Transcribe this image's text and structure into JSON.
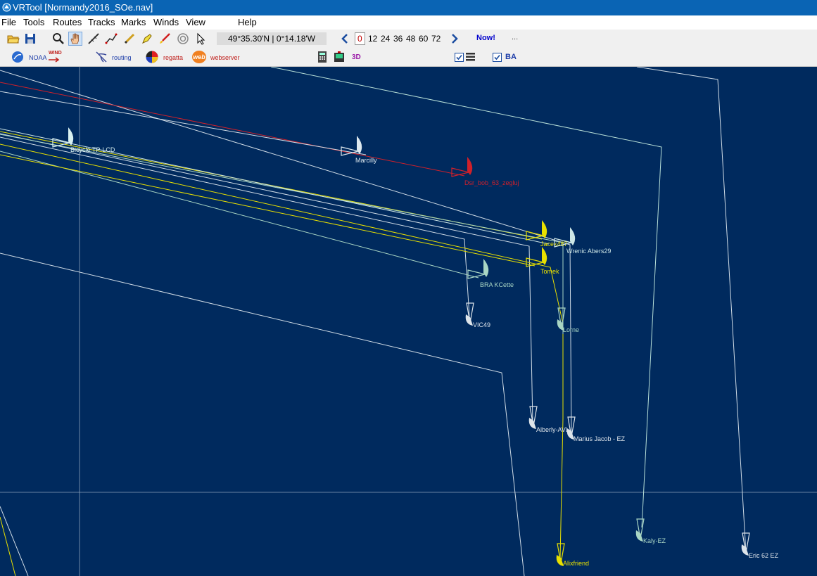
{
  "window": {
    "title": "VRTool [Normandy2016_SOe.nav]"
  },
  "menu": {
    "items": [
      "File",
      "Tools",
      "Routes",
      "Tracks",
      "Marks",
      "Winds",
      "View",
      "Help"
    ]
  },
  "toolbar": {
    "coordinates": "49°35.30'N | 0°14.18'W",
    "hours": [
      "0",
      "12",
      "24",
      "36",
      "48",
      "60",
      "72"
    ],
    "selected_hour": "0",
    "now_label": "Now!",
    "more_label": "...",
    "noaa_label": "NOAA",
    "wind_label": "WIND",
    "routing_label": "routing",
    "regatta_label": "regatta",
    "webserver_label": "webserver",
    "web_badge": "web",
    "three_d_label": "3D",
    "ba_label": "BA",
    "ba_checked": true,
    "layers_checked": true
  },
  "map": {
    "background": "#002a5e",
    "boats": [
      {
        "name": "Bicycle TP-LCD",
        "color": "#d8f0f0"
      },
      {
        "name": "Marcilly",
        "color": "#dde8ee"
      },
      {
        "name": "Dsr_bob_63_zegluj",
        "color": "#d0202a"
      },
      {
        "name": "Jacek487",
        "color": "#e8e000"
      },
      {
        "name": "Wrenic Abers29",
        "color": "#cde6e6"
      },
      {
        "name": "Tomek",
        "color": "#e8e000"
      },
      {
        "name": "BRA KCette",
        "color": "#a9d6c4"
      },
      {
        "name": "VIC49",
        "color": "#dde4ea"
      },
      {
        "name": "Lorne",
        "color": "#a9d6c4"
      },
      {
        "name": "Alberly-AVL",
        "color": "#dde4ea"
      },
      {
        "name": "Marius Jacob - EZ",
        "color": "#dde4ea"
      },
      {
        "name": "Kaly-EZ",
        "color": "#a9d6c4"
      },
      {
        "name": "Eric 62 EZ",
        "color": "#dde4ea"
      },
      {
        "name": "Alixfriend",
        "color": "#e8e000"
      }
    ]
  }
}
